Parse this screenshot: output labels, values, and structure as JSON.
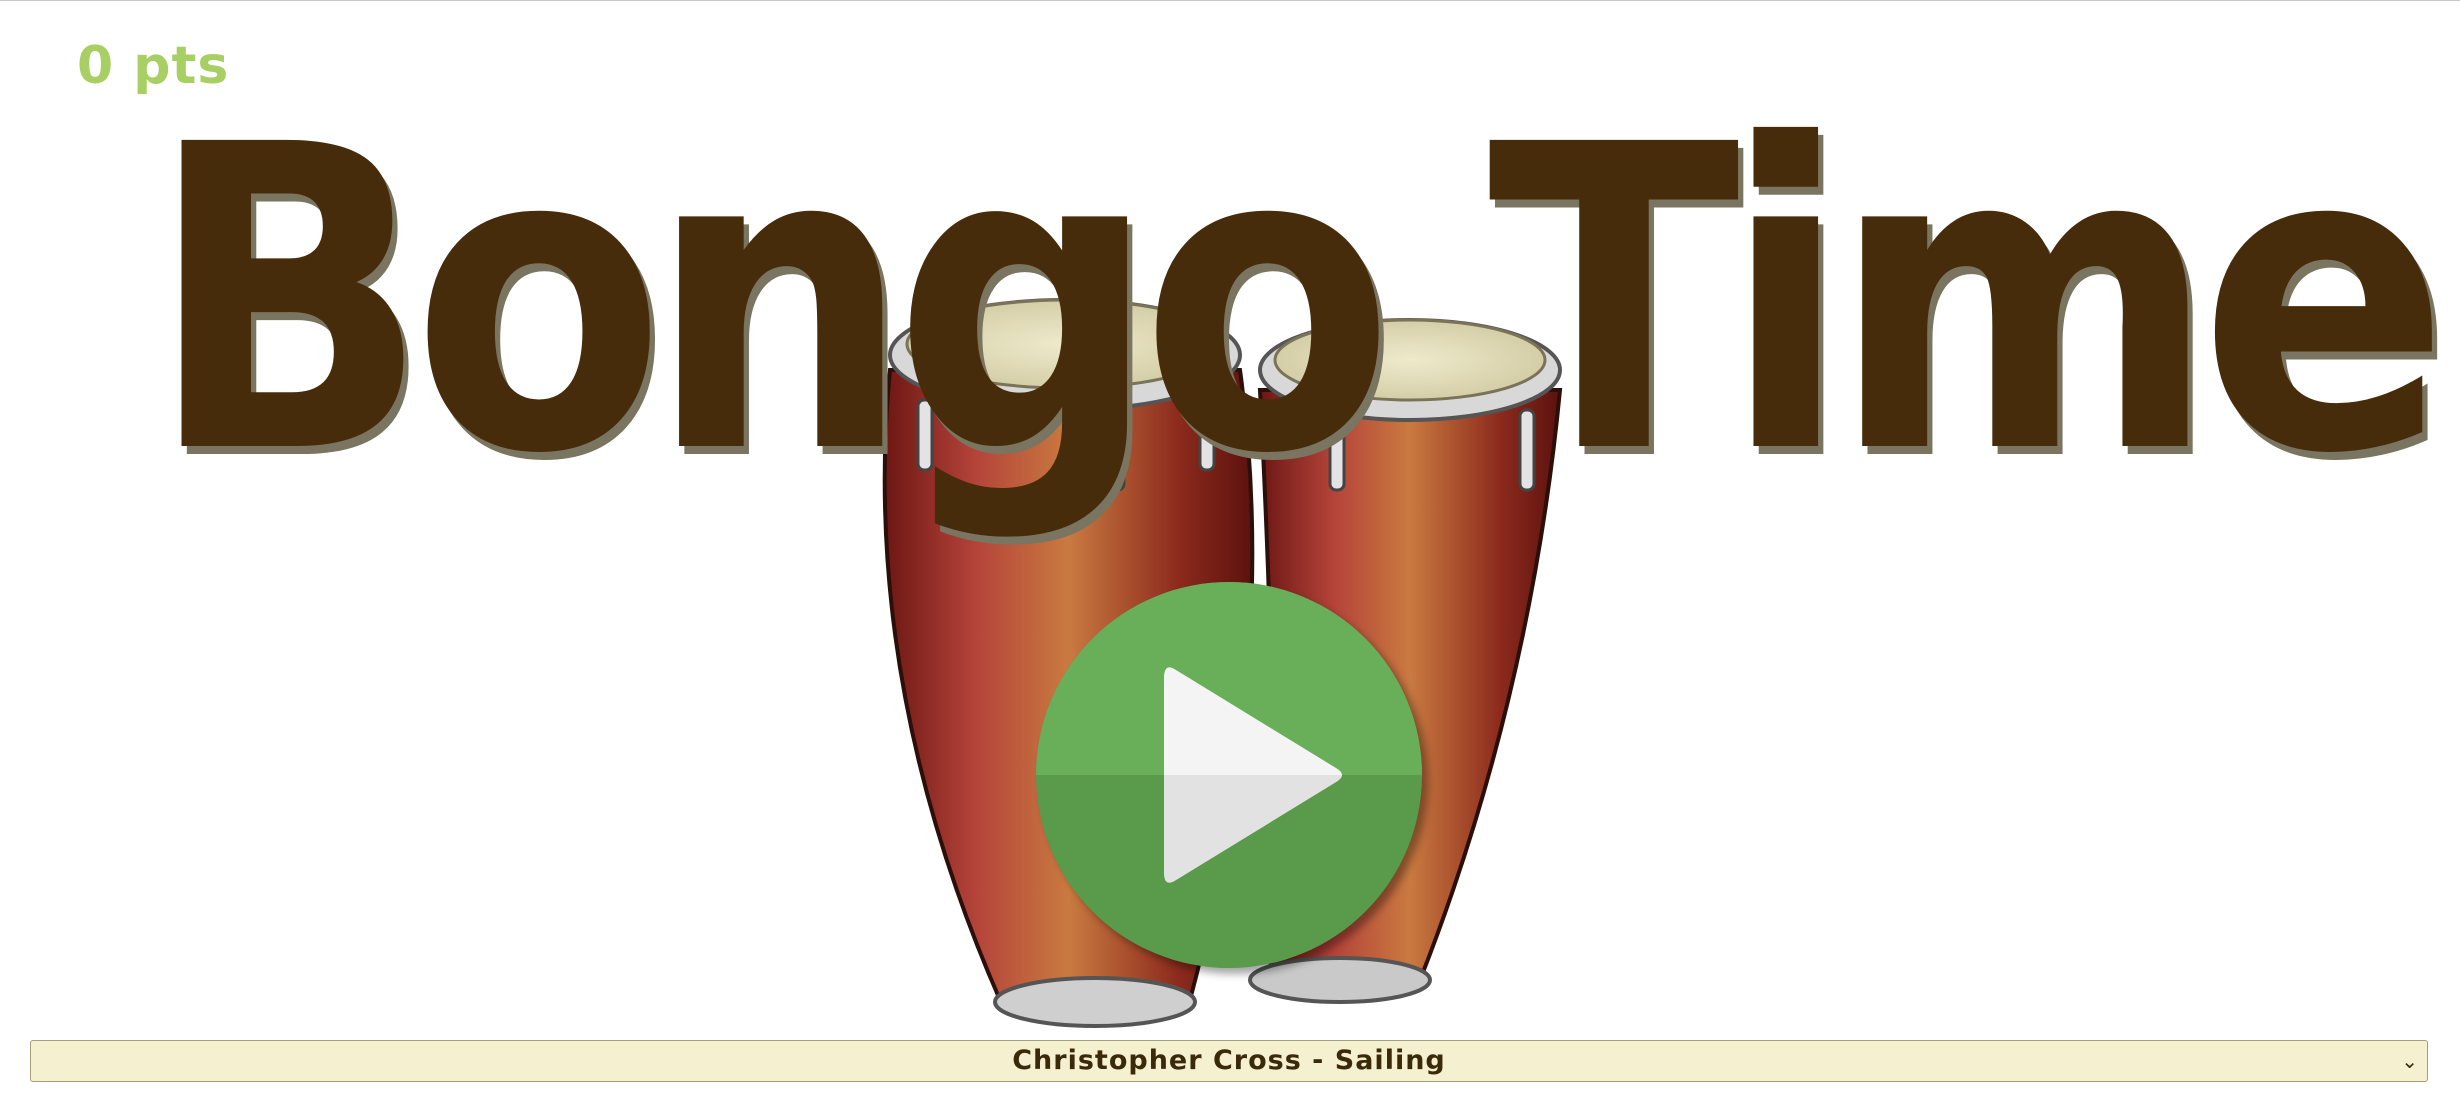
{
  "score": {
    "text": "0 pts"
  },
  "title": {
    "text": "Bongo Time"
  },
  "play_button": {
    "icon": "play-icon"
  },
  "song_select": {
    "selected": "Christopher Cross - Sailing",
    "icon": "chevron-down-icon"
  },
  "colors": {
    "title": "#472c0b",
    "score": "#a8cf63",
    "play_button": "#5a9a4b",
    "select_bg": "#f5f1d0"
  }
}
